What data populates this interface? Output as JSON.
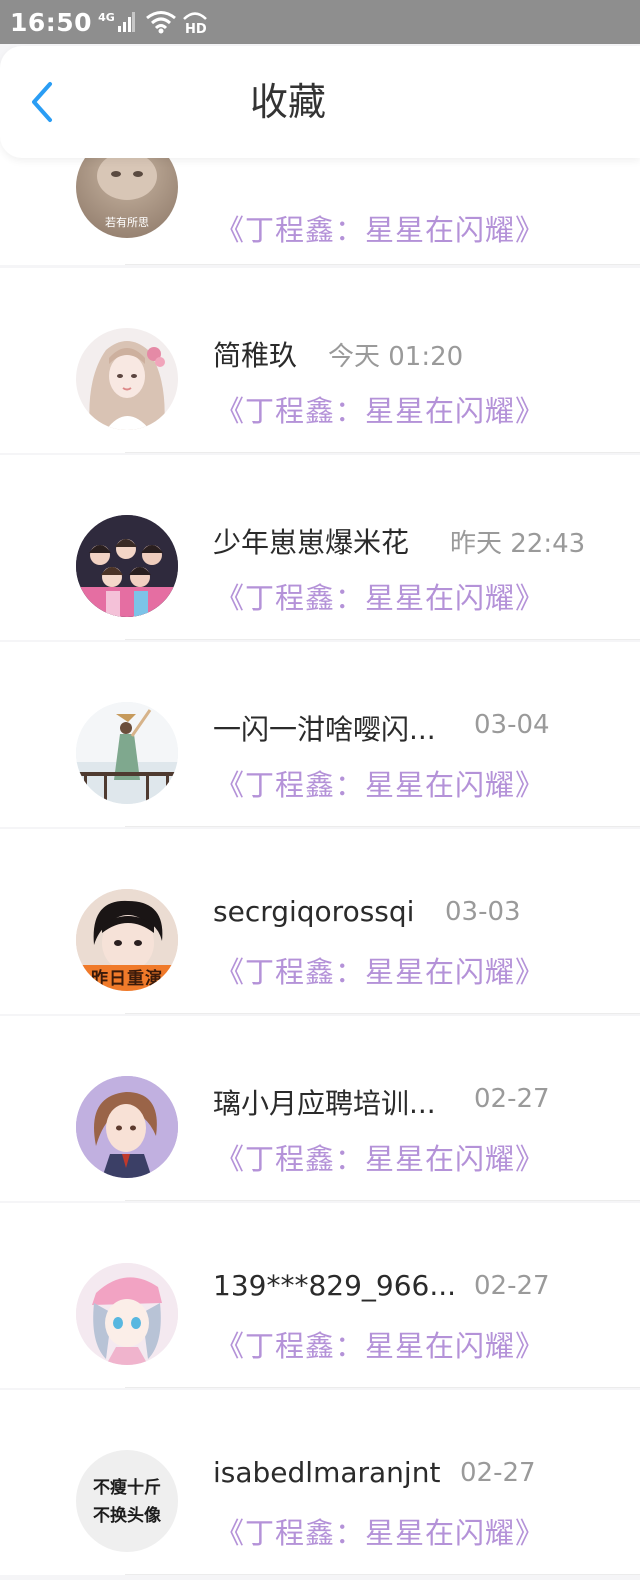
{
  "status_bar": {
    "time": "16:50",
    "network": "4G"
  },
  "header": {
    "title": "收藏"
  },
  "items": [
    {
      "name": "",
      "time": "",
      "book": "《丁程鑫：星星在闪耀》",
      "avatar_text": "若有所思"
    },
    {
      "name": "简稚玖",
      "time": "今天 01:20",
      "book": "《丁程鑫：星星在闪耀》",
      "avatar_text": ""
    },
    {
      "name": "少年崽崽爆米花",
      "time": "昨天 22:43",
      "book": "《丁程鑫：星星在闪耀》",
      "avatar_text": ""
    },
    {
      "name": "一闪一泔啥嘤闪...",
      "time": "03-04",
      "book": "《丁程鑫：星星在闪耀》",
      "avatar_text": ""
    },
    {
      "name": "secrgiqorossqi",
      "time": "03-03",
      "book": "《丁程鑫：星星在闪耀》",
      "avatar_text": "昨日重演"
    },
    {
      "name": "璃小月应聘培训...",
      "time": "02-27",
      "book": "《丁程鑫：星星在闪耀》",
      "avatar_text": ""
    },
    {
      "name": "139***829_966...",
      "time": "02-27",
      "book": "《丁程鑫：星星在闪耀》",
      "avatar_text": ""
    },
    {
      "name": "isabedlmaranjnt",
      "time": "02-27",
      "book": "《丁程鑫：星星在闪耀》",
      "avatar_text": "不瘦十斤 不换头像"
    }
  ],
  "colors": {
    "accent": "#2a9df4",
    "book_title": "#b492d8",
    "status_bar": "#8e8e8e"
  }
}
